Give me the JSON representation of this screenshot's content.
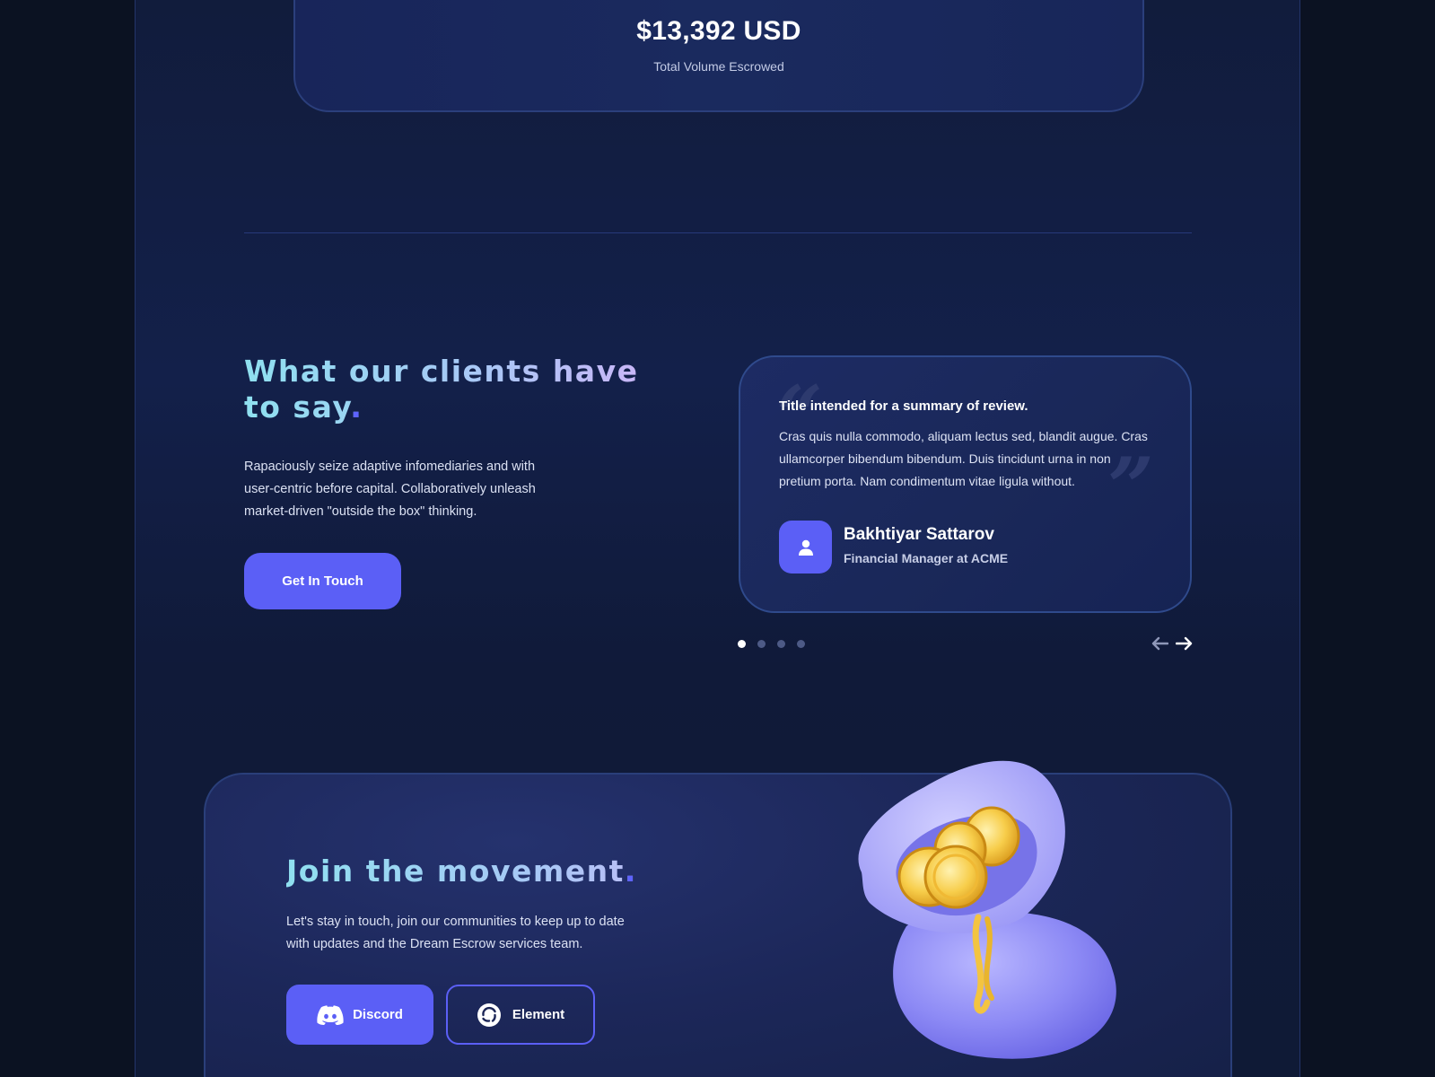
{
  "stats": {
    "value": "$13,392 USD",
    "label": "Total Volume Escrowed"
  },
  "testimonials": {
    "heading_main": "What our clients have to say",
    "heading_dot": ".",
    "description": "Rapaciously seize adaptive infomediaries and with user-centric before capital. Collaboratively unleash market-driven \"outside the box\" thinking.",
    "cta_label": "Get In Touch",
    "review": {
      "title": "Title intended for a summary of review.",
      "text": "Cras quis nulla commodo, aliquam lectus sed, blandit augue. Cras ullamcorper bibendum bibendum. Duis tincidunt urna in non pretium porta. Nam condimentum vitae ligula without.",
      "name": "Bakhtiyar Sattarov",
      "role": "Financial Manager at ACME",
      "avatar_icon": "user-icon"
    },
    "pagination": {
      "count": 4,
      "active_index": 0
    },
    "arrows": {
      "prev_icon": "arrow-left-icon",
      "next_icon": "arrow-right-icon"
    }
  },
  "join": {
    "heading_main": "Join the movement",
    "heading_dot": ".",
    "description": "Let's stay in touch, join our communities to keep up to date with updates and the Dream Escrow services team.",
    "discord_label": "Discord",
    "discord_icon": "discord-icon",
    "element_label": "Element",
    "element_icon": "element-icon",
    "illustration": "money-bag-with-coins-illustration"
  },
  "colors": {
    "accent": "#5b5ff6",
    "background": "#0b1222",
    "heading_gradient_start": "#8fe0f0",
    "heading_gradient_end": "#c8b6f7"
  }
}
